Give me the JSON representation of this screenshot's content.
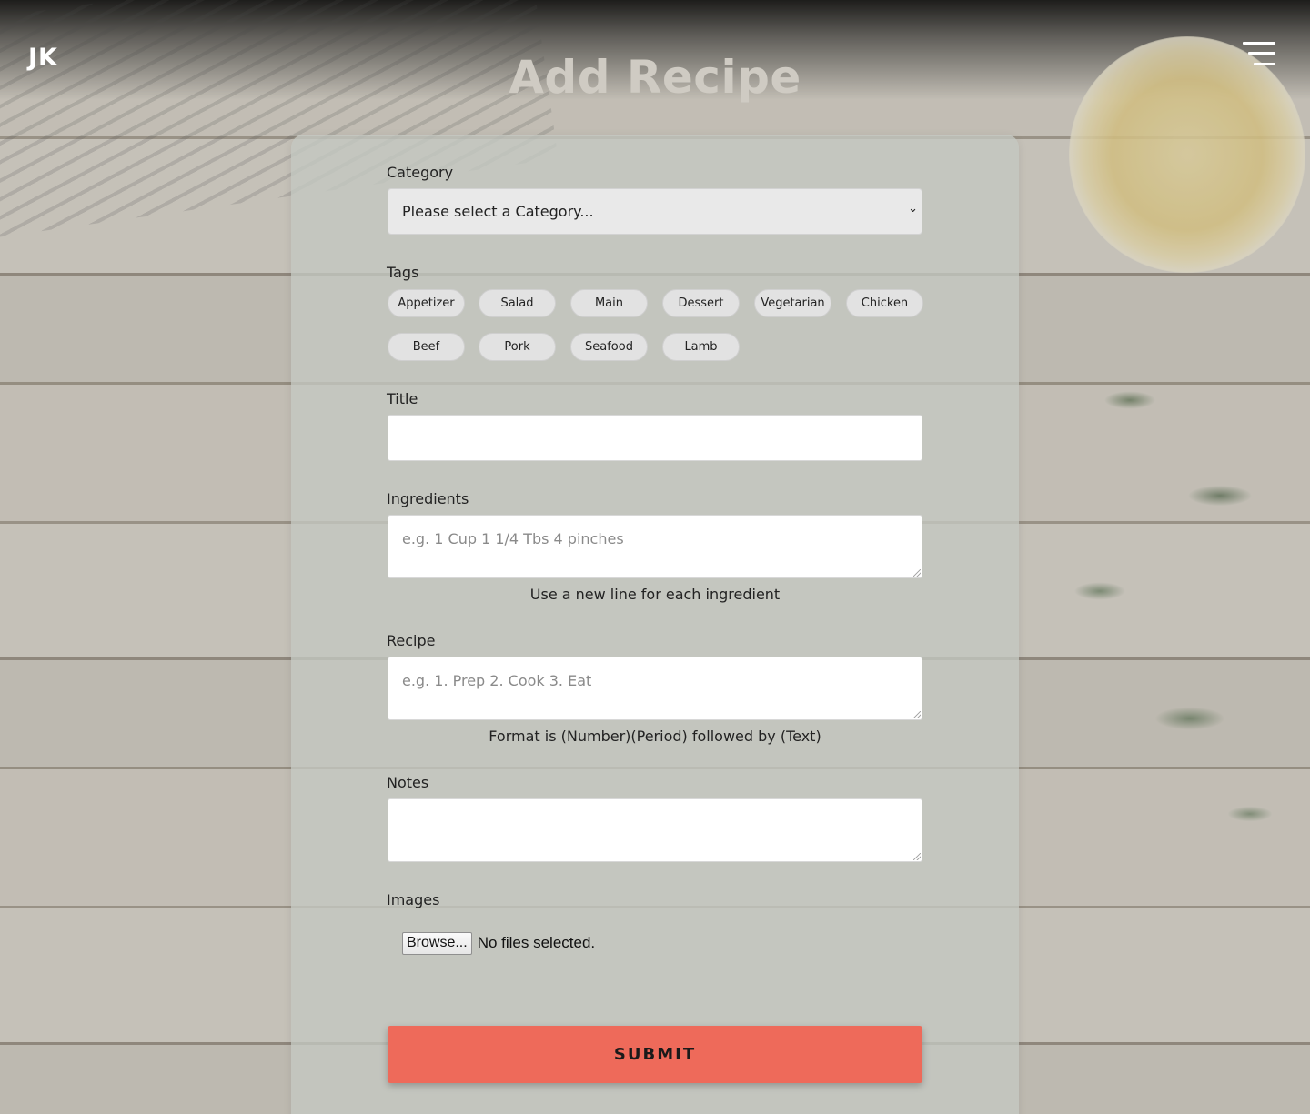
{
  "header": {
    "logo": "JK",
    "menu_icon": "hamburger-menu-icon",
    "title": "Add Recipe"
  },
  "form": {
    "category": {
      "label": "Category",
      "selected": "Please select a Category..."
    },
    "tags": {
      "label": "Tags",
      "items": [
        "Appetizer",
        "Salad",
        "Main",
        "Dessert",
        "Vegetarian",
        "Chicken",
        "Beef",
        "Pork",
        "Seafood",
        "Lamb"
      ]
    },
    "title": {
      "label": "Title",
      "value": ""
    },
    "ingredients": {
      "label": "Ingredients",
      "placeholder": "e.g.  1 Cup 1 1/4 Tbs 4 pinches",
      "hint": "Use a new line for each ingredient"
    },
    "recipe": {
      "label": "Recipe",
      "placeholder": "e.g.  1. Prep 2. Cook 3. Eat",
      "hint": "Format is (Number)(Period) followed by (Text)"
    },
    "notes": {
      "label": "Notes",
      "value": ""
    },
    "images": {
      "label": "Images",
      "browse_label": "Browse...",
      "status": "No files selected."
    },
    "submit_label": "SUBMIT"
  },
  "colors": {
    "accent": "#ee6a5a",
    "card": "#c4c8c1",
    "title": "#cfcbc3"
  }
}
